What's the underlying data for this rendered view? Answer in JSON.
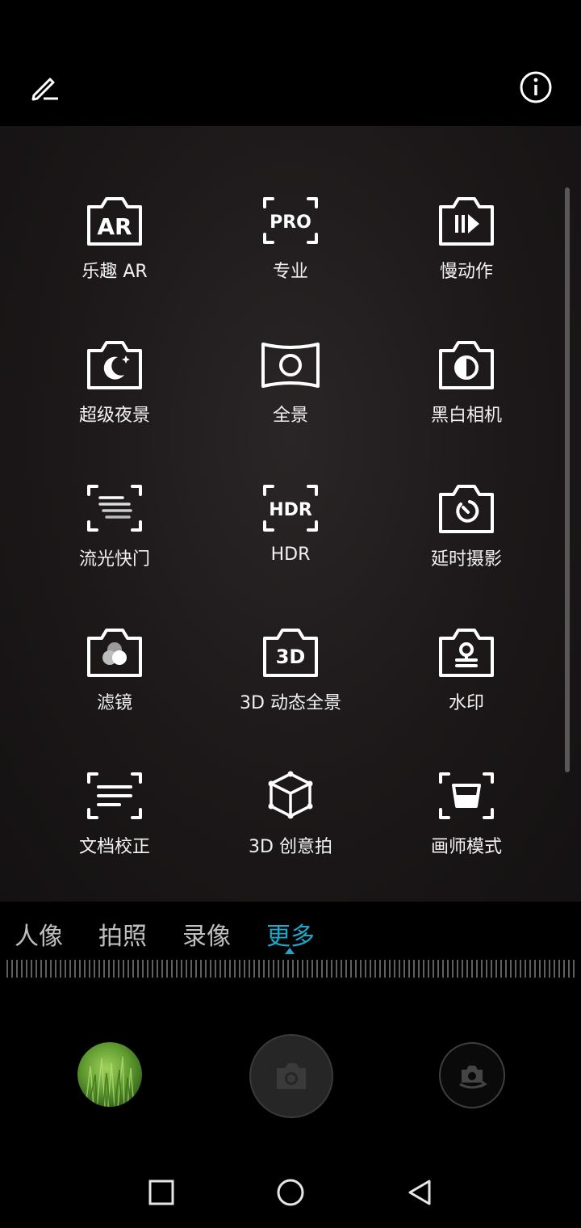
{
  "top_bar": {
    "edit_icon": "pencil-icon",
    "info_icon": "info-icon"
  },
  "modes": [
    {
      "label": "乐趣 AR",
      "icon": "ar-icon",
      "icon_text": "AR"
    },
    {
      "label": "专业",
      "icon": "pro-icon",
      "icon_text": "PRO"
    },
    {
      "label": "慢动作",
      "icon": "slow-motion-icon"
    },
    {
      "label": "超级夜景",
      "icon": "night-icon"
    },
    {
      "label": "全景",
      "icon": "panorama-icon"
    },
    {
      "label": "黑白相机",
      "icon": "monochrome-icon"
    },
    {
      "label": "流光快门",
      "icon": "light-painting-icon"
    },
    {
      "label": "HDR",
      "icon": "hdr-icon",
      "icon_text": "HDR"
    },
    {
      "label": "延时摄影",
      "icon": "time-lapse-icon"
    },
    {
      "label": "滤镜",
      "icon": "filter-icon"
    },
    {
      "label": "3D 动态全景",
      "icon": "3d-panorama-icon",
      "icon_text": "3D"
    },
    {
      "label": "水印",
      "icon": "watermark-icon"
    },
    {
      "label": "文档校正",
      "icon": "document-scan-icon"
    },
    {
      "label": "3D 创意拍",
      "icon": "3d-creative-icon"
    },
    {
      "label": "画师模式",
      "icon": "painter-mode-icon"
    }
  ],
  "tabs": [
    {
      "label": "人像",
      "active": false
    },
    {
      "label": "拍照",
      "active": false
    },
    {
      "label": "录像",
      "active": false
    },
    {
      "label": "更多",
      "active": true
    }
  ],
  "controls": {
    "gallery": "gallery-thumbnail",
    "shutter": "camera-icon",
    "switch": "switch-camera-icon"
  },
  "nav": {
    "recents": "square-icon",
    "home": "circle-icon",
    "back": "triangle-back-icon"
  },
  "colors": {
    "accent": "#1da7c9",
    "background": "#000000",
    "panel": "#1c1819"
  }
}
